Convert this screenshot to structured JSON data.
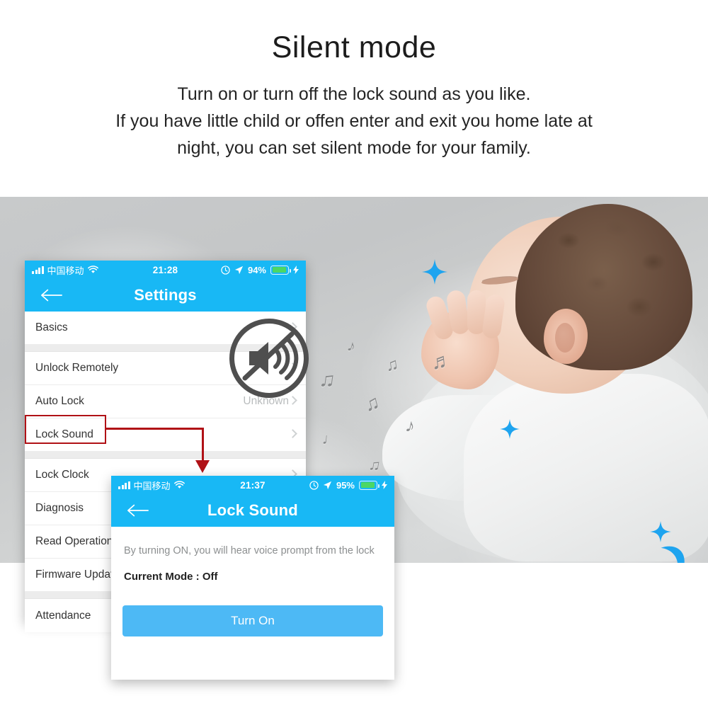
{
  "header": {
    "title": "Silent mode",
    "subtitle_lines": [
      "Turn on or turn off the lock sound as you like.",
      "If you have little child or offen enter and exit you home late at",
      "night, you can set silent mode for your family."
    ]
  },
  "colors": {
    "accent_blue": "#18b8f5",
    "button_blue": "#4db9f5",
    "highlight_red": "#b01116",
    "battery_green": "#4cd764",
    "decoration_blue": "#1ea4ef"
  },
  "phone_settings": {
    "status": {
      "carrier": "中国移动",
      "time": "21:28",
      "battery_percent": "94%",
      "signal_icon": "signal-bars-icon",
      "wifi_icon": "wifi-icon",
      "alarm_icon": "alarm-icon",
      "location_icon": "location-arrow-icon",
      "battery_icon": "battery-icon",
      "charging_icon": "lightning-bolt-icon"
    },
    "nav": {
      "title": "Settings",
      "back_icon": "back-arrow-icon"
    },
    "rows": [
      {
        "label": "Basics",
        "value": "",
        "chevron": true
      },
      {
        "label": "Unlock Remotely",
        "value": "",
        "chevron": true
      },
      {
        "label": "Auto Lock",
        "value": "Unknown",
        "chevron": true
      },
      {
        "label": "Lock Sound",
        "value": "",
        "chevron": true
      },
      {
        "label": "Lock Clock",
        "value": "",
        "chevron": true
      },
      {
        "label": "Diagnosis",
        "value": "",
        "chevron": true
      },
      {
        "label": "Read Operation",
        "value": "",
        "chevron": true
      },
      {
        "label": "Firmware Update",
        "value": "",
        "chevron": true
      },
      {
        "label": "Attendance",
        "value": "",
        "chevron": true
      }
    ],
    "highlighted_row": "Lock Sound"
  },
  "phone_locksound": {
    "status": {
      "carrier": "中国移动",
      "time": "21:37",
      "battery_percent": "95%",
      "signal_icon": "signal-bars-icon",
      "wifi_icon": "wifi-icon",
      "alarm_icon": "alarm-icon",
      "location_icon": "location-arrow-icon",
      "battery_icon": "battery-icon",
      "charging_icon": "lightning-bolt-icon"
    },
    "nav": {
      "title": "Lock Sound",
      "back_icon": "back-arrow-icon"
    },
    "description": "By turning ON, you will hear voice prompt from the lock",
    "current_mode": "Current Mode : Off",
    "action_button": "Turn On"
  },
  "decorations": {
    "mute_icon": "mute-speaker-icon",
    "moon_icon": "crescent-moon-icon",
    "sparkle_icon": "sparkle-icon",
    "music_note_glyphs": [
      "♪",
      "♫",
      "♬",
      "♪",
      "♫",
      "♩",
      "♫",
      "♪",
      "♬",
      "♫"
    ]
  }
}
